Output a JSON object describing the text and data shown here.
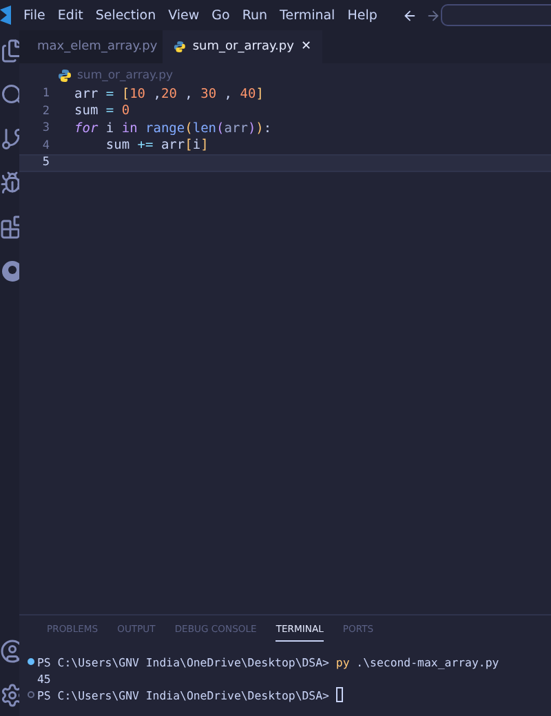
{
  "menu": [
    "File",
    "Edit",
    "Selection",
    "View",
    "Go",
    "Run",
    "Terminal",
    "Help"
  ],
  "tabs": [
    {
      "label": "max_elem_array.py",
      "selected": false
    },
    {
      "label": "sum_or_array.py",
      "selected": true,
      "close": "✕"
    }
  ],
  "breadcrumb": "sum_or_array.py",
  "code": [
    {
      "number": "1",
      "current": false,
      "tokens": [
        {
          "text": "arr",
          "kind": "var"
        },
        {
          "text": " = ",
          "kind": "op"
        },
        {
          "text": "[",
          "kind": "bracket"
        },
        {
          "text": "10",
          "kind": "num"
        },
        {
          "text": " ,",
          "kind": "punct"
        },
        {
          "text": "20",
          "kind": "num"
        },
        {
          "text": " , ",
          "kind": "punct"
        },
        {
          "text": "30",
          "kind": "num"
        },
        {
          "text": " , ",
          "kind": "punct"
        },
        {
          "text": "40",
          "kind": "num"
        },
        {
          "text": "]",
          "kind": "bracket"
        }
      ]
    },
    {
      "number": "2",
      "current": false,
      "tokens": [
        {
          "text": "sum",
          "kind": "var"
        },
        {
          "text": " = ",
          "kind": "op"
        },
        {
          "text": "0",
          "kind": "num"
        }
      ]
    },
    {
      "number": "3",
      "current": false,
      "tokens": [
        {
          "text": "for",
          "kind": "keyword"
        },
        {
          "text": " i ",
          "kind": "var"
        },
        {
          "text": "in",
          "kind": "keyword"
        },
        {
          "text": " range",
          "kind": "func"
        },
        {
          "text": "(",
          "kind": "bracket"
        },
        {
          "text": "len",
          "kind": "func"
        },
        {
          "text": "(",
          "kind": "bracket2"
        },
        {
          "text": "arr",
          "kind": "param"
        },
        {
          "text": ")",
          "kind": "bracket2"
        },
        {
          "text": ")",
          "kind": "bracket"
        },
        {
          "text": ":",
          "kind": "punct"
        }
      ]
    },
    {
      "number": "4",
      "current": false,
      "tokens": [
        {
          "text": "    sum",
          "kind": "var"
        },
        {
          "text": " += ",
          "kind": "op"
        },
        {
          "text": "arr",
          "kind": "var"
        },
        {
          "text": "[",
          "kind": "bracket"
        },
        {
          "text": "i",
          "kind": "var"
        },
        {
          "text": "]",
          "kind": "bracket"
        }
      ]
    },
    {
      "number": "5",
      "current": true
    }
  ],
  "panel_tabs": [
    {
      "label": "PROBLEMS",
      "selected": false
    },
    {
      "label": "OUTPUT",
      "selected": false
    },
    {
      "label": "DEBUG CONSOLE",
      "selected": false
    },
    {
      "label": "TERMINAL",
      "selected": true
    },
    {
      "label": "PORTS",
      "selected": false
    }
  ],
  "terminal": [
    {
      "kind": "prompt",
      "succeeded": true,
      "segments": [
        {
          "text": "PS C:\\Users\\GNV India\\OneDrive\\Desktop\\DSA> ",
          "kind": "plain"
        },
        {
          "text": "py",
          "kind": "command"
        },
        {
          "text": " .\\second-max_array.py",
          "kind": "plain"
        }
      ]
    },
    {
      "kind": "output",
      "segments": [
        {
          "text": "45",
          "kind": "plain"
        }
      ]
    },
    {
      "kind": "prompt",
      "succeeded": false,
      "cursor": true,
      "segments": [
        {
          "text": "PS C:\\Users\\GNV India\\OneDrive\\Desktop\\DSA> ",
          "kind": "plain"
        }
      ]
    }
  ]
}
